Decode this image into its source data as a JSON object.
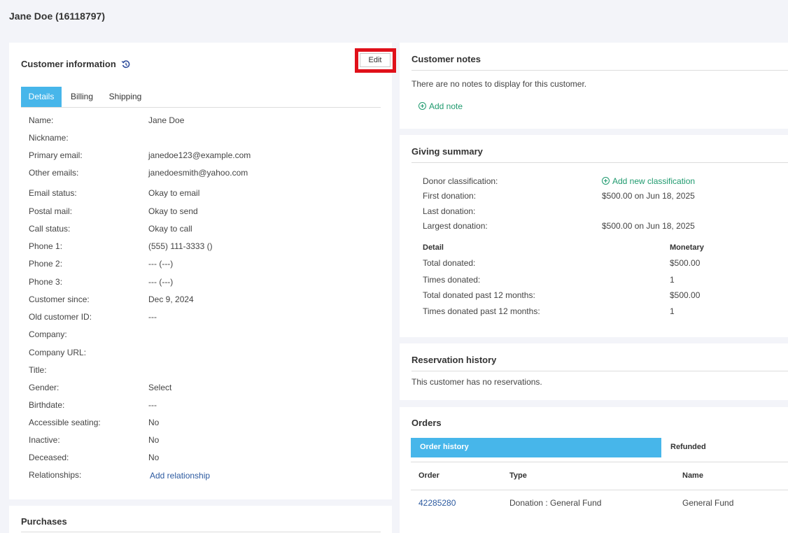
{
  "page": {
    "title": "Jane Doe (16118797)"
  },
  "customer_info": {
    "title": "Customer information",
    "edit_label": "Edit",
    "tabs": [
      "Details",
      "Billing",
      "Shipping"
    ],
    "fields": [
      {
        "label": "Name:",
        "value": "Jane Doe"
      },
      {
        "label": "Nickname:",
        "value": ""
      },
      {
        "label": "Primary email:",
        "value": "janedoe123@example.com"
      },
      {
        "label": "Other emails:",
        "value": "janedoesmith@yahoo.com"
      },
      {
        "label": "Email status:",
        "value": "Okay to email"
      },
      {
        "label": "Postal mail:",
        "value": "Okay to send"
      },
      {
        "label": "Call status:",
        "value": "Okay to call"
      },
      {
        "label": "Phone 1:",
        "value": "(555) 111-3333 ()"
      },
      {
        "label": "Phone 2:",
        "value": "--- (---)"
      },
      {
        "label": "Phone 3:",
        "value": "--- (---)"
      },
      {
        "label": "Customer since:",
        "value": "Dec 9, 2024"
      },
      {
        "label": "Old customer ID:",
        "value": "---"
      },
      {
        "label": "Company:",
        "value": ""
      },
      {
        "label": "Company URL:",
        "value": ""
      },
      {
        "label": "Title:",
        "value": ""
      },
      {
        "label": "Gender:",
        "value": "Select"
      },
      {
        "label": "Birthdate:",
        "value": "---"
      },
      {
        "label": "Accessible seating:",
        "value": "No"
      },
      {
        "label": "Inactive:",
        "value": "No"
      },
      {
        "label": "Deceased:",
        "value": "No"
      },
      {
        "label": "Relationships:",
        "value": "Add relationship"
      }
    ]
  },
  "purchases": {
    "title": "Purchases"
  },
  "notes": {
    "title": "Customer notes",
    "empty_text": "There are no notes to display for this customer.",
    "add_label": "Add note"
  },
  "giving": {
    "title": "Giving summary",
    "rows": [
      {
        "label": "Donor classification:",
        "value": "Add new classification"
      },
      {
        "label": "First donation:",
        "value": "$500.00 on Jun 18, 2025"
      },
      {
        "label": "Last donation:",
        "value": ""
      },
      {
        "label": "Largest donation:",
        "value": "$500.00 on Jun 18, 2025"
      }
    ],
    "detail_header": "Detail",
    "monetary_header": "Monetary",
    "details": [
      {
        "label": "Total donated:",
        "value": "$500.00"
      },
      {
        "label": "Times donated:",
        "value": "1"
      },
      {
        "label": "Total donated past 12 months:",
        "value": "$500.00"
      },
      {
        "label": "Times donated past 12 months:",
        "value": "1"
      }
    ]
  },
  "reservations": {
    "title": "Reservation history",
    "empty_text": "This customer has no reservations."
  },
  "orders": {
    "title": "Orders",
    "tabs": [
      "Order history",
      "Refunded"
    ],
    "columns": [
      "Order",
      "Type",
      "Name"
    ],
    "rows": [
      {
        "order": "42285280",
        "type": "Donation : General Fund",
        "name": "General Fund"
      }
    ]
  },
  "colors": {
    "accent": "#47b6ea",
    "link": "#2c5aa0",
    "green": "#1f9a6e",
    "highlight": "#e0101a"
  },
  "icons": {
    "history": "history-icon",
    "add": "plus-circle-icon"
  }
}
